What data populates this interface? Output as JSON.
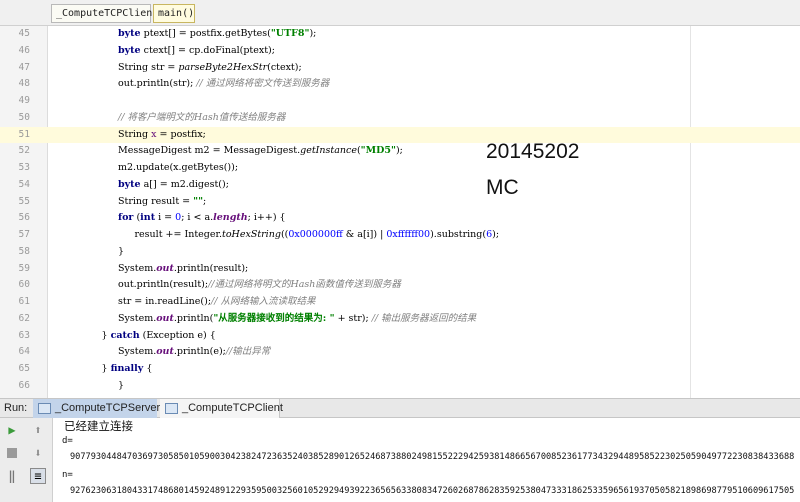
{
  "breadcrumb": [
    "_ComputeTCPClient",
    "main()"
  ],
  "editor": {
    "lines": [
      {
        "n": "45",
        "indent": 4,
        "tokens": [
          {
            "t": "byte",
            "c": "kw"
          },
          {
            "t": " ptext[] = postfix.getBytes("
          },
          {
            "t": "\"UTF8\"",
            "c": "str"
          },
          {
            "t": ");"
          }
        ]
      },
      {
        "n": "46",
        "indent": 4,
        "tokens": [
          {
            "t": "byte",
            "c": "kw"
          },
          {
            "t": " ctext[] = cp.doFinal(ptext);"
          }
        ]
      },
      {
        "n": "47",
        "indent": 4,
        "tokens": [
          {
            "t": "String str = "
          },
          {
            "t": "parseByte2HexStr",
            "c": "it"
          },
          {
            "t": "(ctext);"
          }
        ]
      },
      {
        "n": "48",
        "indent": 4,
        "tokens": [
          {
            "t": "out.println(str); "
          },
          {
            "t": "// 通过网络将密文传送到服务器",
            "c": "cmt"
          }
        ]
      },
      {
        "n": "49",
        "indent": 4,
        "tokens": []
      },
      {
        "n": "50",
        "indent": 4,
        "tokens": [
          {
            "t": "// 将客户端明文的Hash值传送给服务器",
            "c": "cmt"
          }
        ]
      },
      {
        "n": "51",
        "indent": 4,
        "current": true,
        "tokens": [
          {
            "t": "String "
          },
          {
            "t": "x",
            "c": "var"
          },
          {
            "t": " = postfix;"
          }
        ]
      },
      {
        "n": "52",
        "indent": 4,
        "tokens": [
          {
            "t": "MessageDigest m2 = MessageDigest."
          },
          {
            "t": "getInstance",
            "c": "it"
          },
          {
            "t": "("
          },
          {
            "t": "\"MD5\"",
            "c": "str"
          },
          {
            "t": ");"
          }
        ]
      },
      {
        "n": "53",
        "indent": 4,
        "tokens": [
          {
            "t": "m2.update(x.getBytes());"
          }
        ]
      },
      {
        "n": "54",
        "indent": 4,
        "tokens": [
          {
            "t": "byte",
            "c": "kw"
          },
          {
            "t": " a[] = m2.digest();"
          }
        ]
      },
      {
        "n": "55",
        "indent": 4,
        "tokens": [
          {
            "t": "String result = "
          },
          {
            "t": "\"\"",
            "c": "str"
          },
          {
            "t": ";"
          }
        ]
      },
      {
        "n": "56",
        "indent": 4,
        "tokens": [
          {
            "t": "for",
            "c": "kw"
          },
          {
            "t": " ("
          },
          {
            "t": "int",
            "c": "kw"
          },
          {
            "t": " i = "
          },
          {
            "t": "0",
            "c": "num"
          },
          {
            "t": "; i < a."
          },
          {
            "t": "length",
            "c": "fld"
          },
          {
            "t": "; i++) {"
          }
        ]
      },
      {
        "n": "57",
        "indent": 6,
        "tokens": [
          {
            "t": "result += Integer."
          },
          {
            "t": "toHexString",
            "c": "it"
          },
          {
            "t": "(("
          },
          {
            "t": "0x000000ff",
            "c": "num"
          },
          {
            "t": " & a[i]) | "
          },
          {
            "t": "0xffffff00",
            "c": "num"
          },
          {
            "t": ").substring("
          },
          {
            "t": "6",
            "c": "num"
          },
          {
            "t": ");"
          }
        ]
      },
      {
        "n": "58",
        "indent": 4,
        "tokens": [
          {
            "t": "}"
          }
        ]
      },
      {
        "n": "59",
        "indent": 4,
        "tokens": [
          {
            "t": "System."
          },
          {
            "t": "out",
            "c": "fld"
          },
          {
            "t": ".println(result);"
          }
        ]
      },
      {
        "n": "60",
        "indent": 4,
        "tokens": [
          {
            "t": "out.println(result);"
          },
          {
            "t": "//通过网络将明文的Hash函数值传送到服务器",
            "c": "cmt"
          }
        ]
      },
      {
        "n": "61",
        "indent": 4,
        "tokens": [
          {
            "t": "str = in.readLine();"
          },
          {
            "t": "// 从网络输入流读取结果",
            "c": "cmt"
          }
        ]
      },
      {
        "n": "62",
        "indent": 4,
        "tokens": [
          {
            "t": "System."
          },
          {
            "t": "out",
            "c": "fld"
          },
          {
            "t": ".println("
          },
          {
            "t": "\"从服务器接收到的结果为: \"",
            "c": "str"
          },
          {
            "t": " + str); "
          },
          {
            "t": "// 输出服务器返回的结果",
            "c": "cmt"
          }
        ]
      },
      {
        "n": "63",
        "indent": 2,
        "tokens": [
          {
            "t": "} "
          },
          {
            "t": "catch",
            "c": "kw"
          },
          {
            "t": " (Exception e) {"
          }
        ]
      },
      {
        "n": "64",
        "indent": 4,
        "tokens": [
          {
            "t": "System."
          },
          {
            "t": "out",
            "c": "fld"
          },
          {
            "t": ".println(e);"
          },
          {
            "t": "//输出异常",
            "c": "cmt"
          }
        ]
      },
      {
        "n": "65",
        "indent": 2,
        "tokens": [
          {
            "t": "} "
          },
          {
            "t": "finally",
            "c": "kw"
          },
          {
            "t": " {"
          }
        ]
      },
      {
        "n": "66",
        "indent": 4,
        "tokens": [
          {
            "t": "}"
          }
        ]
      }
    ]
  },
  "overlay": [
    "20145202",
    "MC"
  ],
  "run": {
    "label": "Run:",
    "tabs": [
      "_ComputeTCPServer",
      "_ComputeTCPClient"
    ],
    "console": [
      "已经建立连接",
      "d=",
      "90779304484703697305850105900304238247236352403852890126524687388024981552229425938148665670085236177343294489585223025059049772230838433688",
      "n=",
      "92762306318043317486801459248912293595003256010529294939223656563380834726026878628359253804733318625335965619370505821898698779510609617505"
    ]
  }
}
